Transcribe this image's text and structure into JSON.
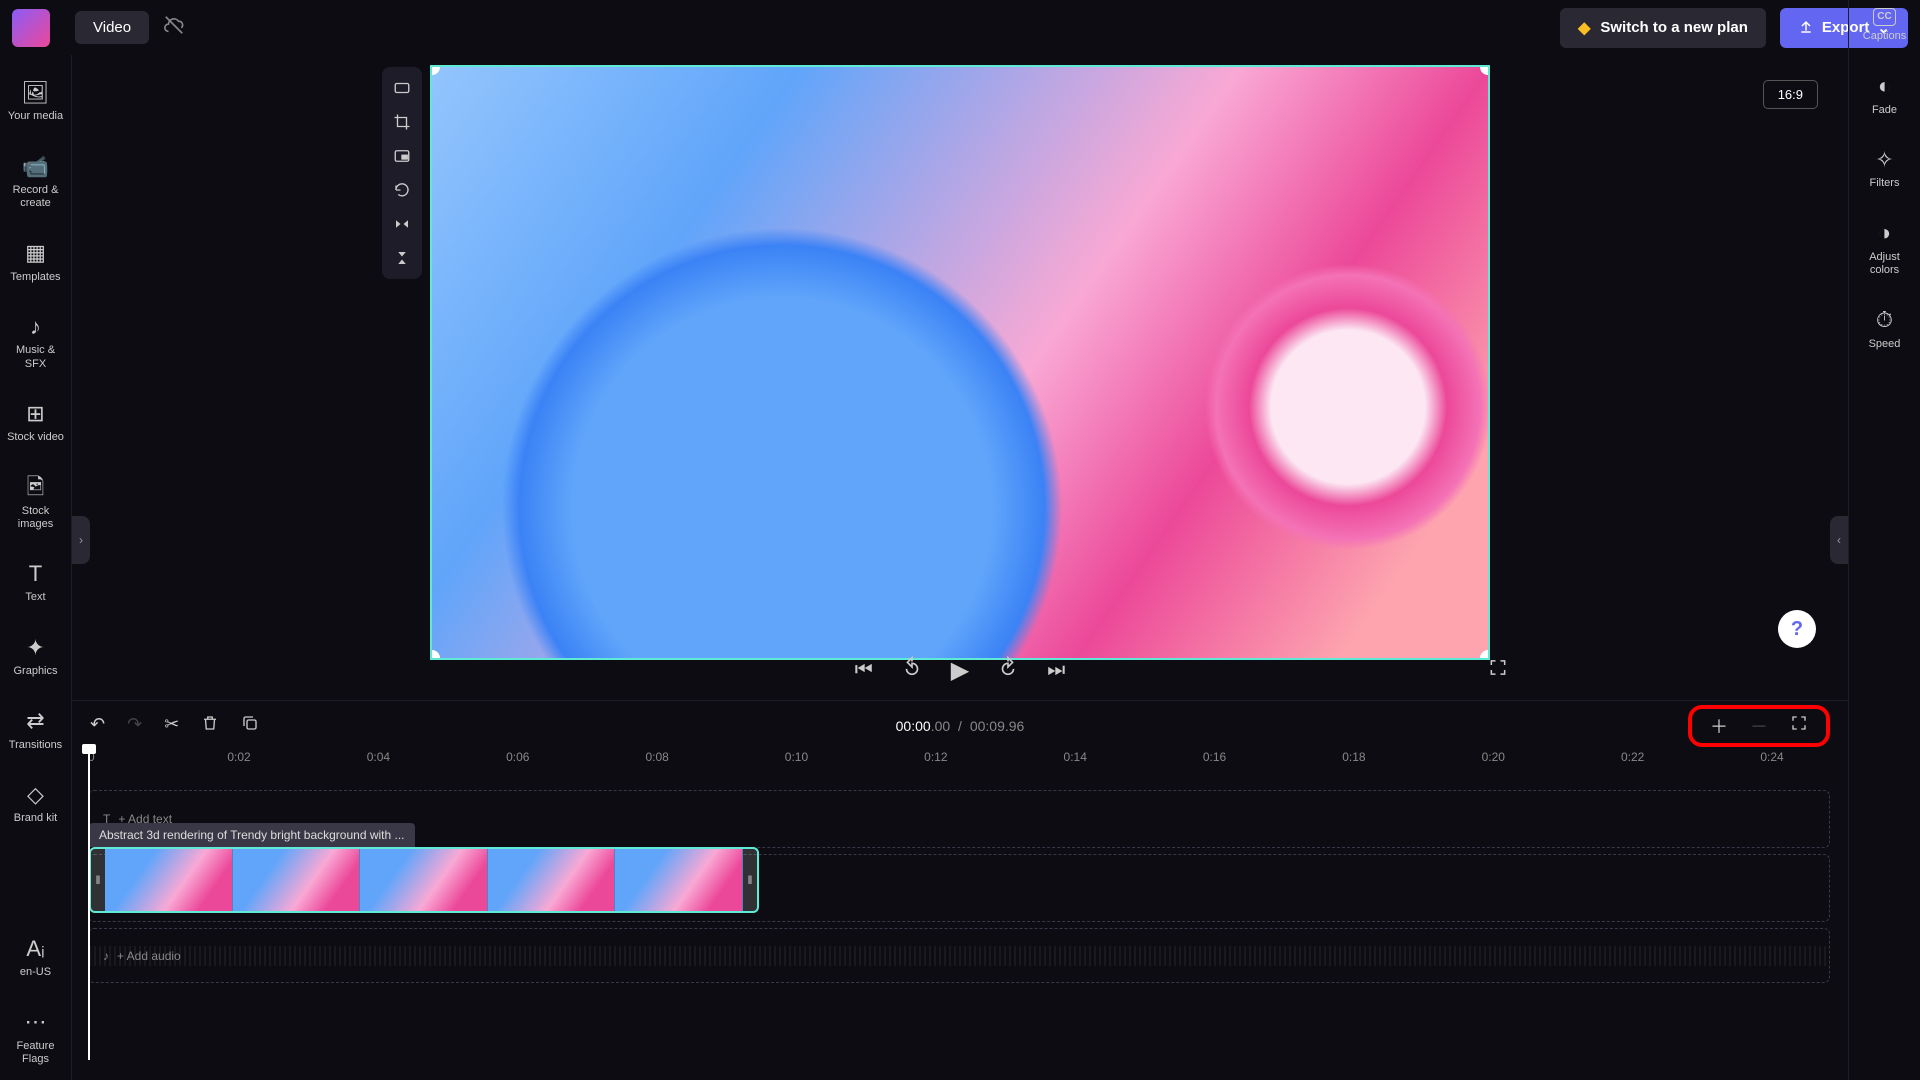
{
  "topbar": {
    "title_chip": "Video",
    "switch_plan": "Switch to a new plan",
    "export": "Export"
  },
  "sidebar_left": [
    {
      "icon": "🖼",
      "label": "Your media"
    },
    {
      "icon": "📹",
      "label": "Record & create"
    },
    {
      "icon": "▦",
      "label": "Templates"
    },
    {
      "icon": "♪",
      "label": "Music & SFX"
    },
    {
      "icon": "⊞",
      "label": "Stock video"
    },
    {
      "icon": "🖻",
      "label": "Stock images"
    },
    {
      "icon": "T",
      "label": "Text"
    },
    {
      "icon": "✦",
      "label": "Graphics"
    },
    {
      "icon": "⇄",
      "label": "Transitions"
    },
    {
      "icon": "◇",
      "label": "Brand kit"
    }
  ],
  "sidebar_left_bottom": [
    {
      "icon": "Aᵢ",
      "label": "en-US"
    },
    {
      "icon": "⋯",
      "label": "Feature Flags"
    }
  ],
  "sidebar_right": [
    {
      "icon": "CC",
      "label": "Captions"
    },
    {
      "icon": "◐",
      "label": "Fade"
    },
    {
      "icon": "✧",
      "label": "Filters"
    },
    {
      "icon": "◑",
      "label": "Adjust colors"
    },
    {
      "icon": "⏱",
      "label": "Speed"
    }
  ],
  "preview": {
    "aspect": "16:9",
    "tools": [
      "fit-icon",
      "crop-icon",
      "pip-icon",
      "rotate-icon",
      "flip-h-icon",
      "flip-v-icon"
    ]
  },
  "timecode": {
    "current_main": "00:00",
    "current_sub": ".00",
    "separator": "/",
    "total_main": "00:09",
    "total_sub": ".96"
  },
  "ruler": [
    "0",
    "0:02",
    "0:04",
    "0:06",
    "0:08",
    "0:10",
    "0:12",
    "0:14",
    "0:16",
    "0:18",
    "0:20",
    "0:22",
    "0:24"
  ],
  "tracks": {
    "text_placeholder": "+ Add text",
    "clip_label": "Abstract 3d rendering of Trendy bright background with ...",
    "audio_placeholder": "+ Add audio"
  }
}
